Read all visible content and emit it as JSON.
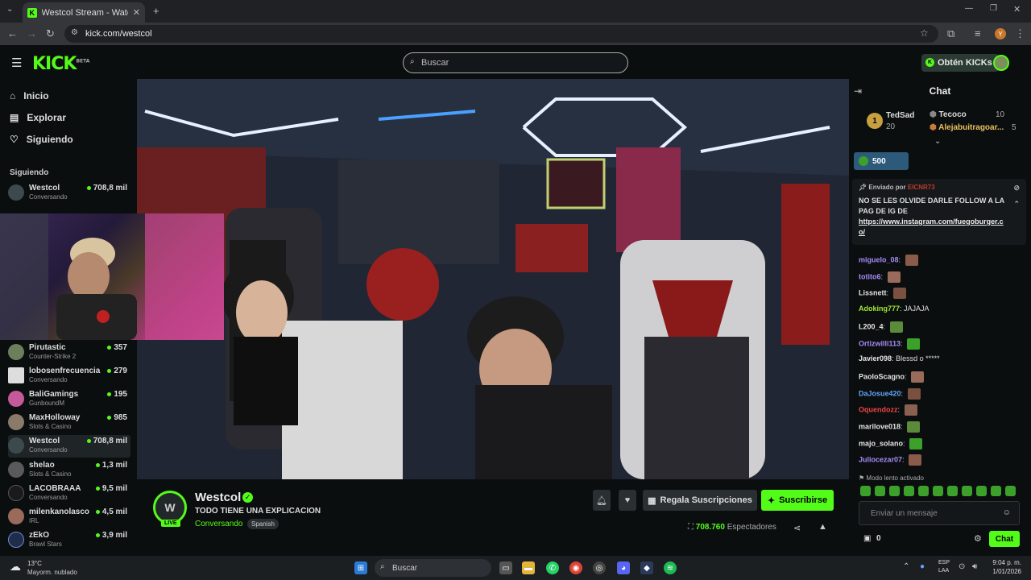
{
  "browser": {
    "tab_title": "Westcol Stream - Watch Li...",
    "url": "kick.com/westcol",
    "profile_initial": "Y"
  },
  "header": {
    "logo": "KICK",
    "logo_badge": "BETA",
    "search_placeholder": "Buscar",
    "get_kicks": "Obtén KICKs"
  },
  "sidebar": {
    "nav": [
      "Inicio",
      "Explorar",
      "Siguiendo"
    ],
    "following_label": "Siguiendo",
    "following": [
      {
        "name": "Westcol",
        "category": "Conversando",
        "viewers": "708,8 mil"
      }
    ],
    "recommended": [
      {
        "name": "Pirutastic",
        "category": "Counter-Strike 2",
        "viewers": "357"
      },
      {
        "name": "lobosenfrecuencia",
        "category": "Conversando",
        "viewers": "279"
      },
      {
        "name": "BaliGamings",
        "category": "GunboundM",
        "viewers": "195"
      },
      {
        "name": "MaxHolloway",
        "category": "Slots & Casino",
        "viewers": "985"
      },
      {
        "name": "Westcol",
        "category": "Conversando",
        "viewers": "708,8 mil"
      },
      {
        "name": "shelao",
        "category": "Slots & Casino",
        "viewers": "1,3 mil"
      },
      {
        "name": "LACOBRAAA",
        "category": "Conversando",
        "viewers": "9,5 mil"
      },
      {
        "name": "milenkanolasco",
        "category": "IRL",
        "viewers": "4,5 mil"
      },
      {
        "name": "zEkO",
        "category": "Brawl Stars",
        "viewers": "3,9 mil"
      }
    ]
  },
  "stream": {
    "channel": "Westcol",
    "live_badge": "LIVE",
    "title": "TODO TIENE UNA EXPLICACION",
    "category": "Conversando",
    "language": "Spanish",
    "gift_button": "Regala Suscripciones",
    "subscribe_button": "Suscribirse",
    "viewer_count": "708.760",
    "viewers_label": "Espectadores"
  },
  "chat": {
    "title": "Chat",
    "top_gifters": [
      {
        "rank": "1",
        "name": "TedSad",
        "count": "20"
      },
      {
        "name": "Tecoco",
        "count": "10"
      },
      {
        "name": "Alejabuitragoar...",
        "count": "5"
      }
    ],
    "points": "500",
    "pinned": {
      "sent_by_label": "Enviado por",
      "sender": "EICNR73",
      "message": "NO SE LES OLVIDE DARLE FOLLOW A LA PAG DE IG DE",
      "link": "https://www.instagram.com/fuegoburger.co/"
    },
    "messages": [
      {
        "user": "miguelo_08",
        "text": "",
        "color": "#a78bfa"
      },
      {
        "user": "totito6",
        "text": "",
        "color": "#a78bfa"
      },
      {
        "user": "Lissnett",
        "text": "",
        "color": "#e5e5e5"
      },
      {
        "user": "Adoking777",
        "text": "JAJAJA",
        "color": "#a3e635"
      },
      {
        "user": "L200_4",
        "text": "",
        "color": "#e5e5e5"
      },
      {
        "user": "Ortizwilli113",
        "text": "",
        "color": "#a78bfa"
      },
      {
        "user": "Javier098",
        "text": "Blessd o *****",
        "color": "#e5e5e5"
      },
      {
        "user": "PaoloScagno",
        "text": "",
        "color": "#e5e5e5"
      },
      {
        "user": "DaJosue420",
        "text": "",
        "color": "#60a5fa"
      },
      {
        "user": "Oquendozz",
        "text": "",
        "color": "#ef4444"
      },
      {
        "user": "marilove018",
        "text": "",
        "color": "#e5e5e5"
      },
      {
        "user": "majo_solano",
        "text": "",
        "color": "#e5e5e5"
      },
      {
        "user": "Juliocezar07",
        "text": "",
        "color": "#a78bfa"
      }
    ],
    "slow_mode": "Modo lento activado",
    "input_placeholder": "Enviar un mensaje",
    "kick_count": "0",
    "send_button": "Chat"
  },
  "taskbar": {
    "temperature": "13°C",
    "weather": "Mayorm. nublado",
    "search": "Buscar",
    "lang_1": "ESP",
    "lang_2": "LAA",
    "time": "9:04 p. m.",
    "date": "1/01/2026"
  }
}
